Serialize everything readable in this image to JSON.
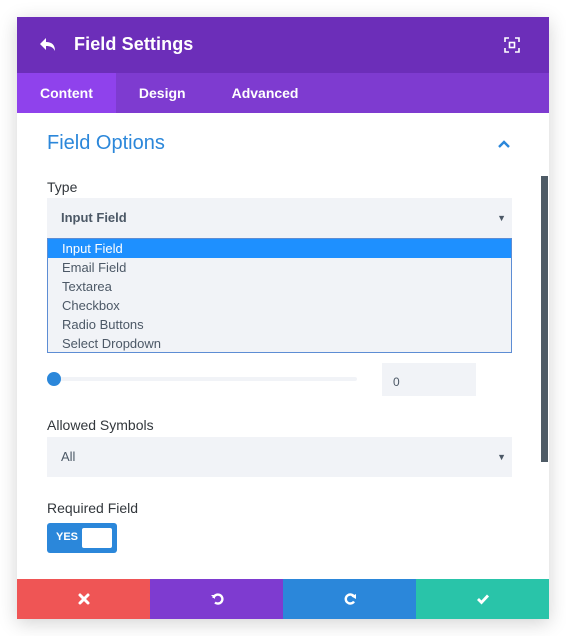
{
  "header": {
    "title": "Field Settings",
    "back_icon": "undo-arrow-icon",
    "expand_icon": "fullscreen-icon"
  },
  "tabs": [
    {
      "label": "Content",
      "active": true
    },
    {
      "label": "Design",
      "active": false
    },
    {
      "label": "Advanced",
      "active": false
    }
  ],
  "section": {
    "title": "Field Options",
    "collapse_icon": "chevron-up-icon"
  },
  "type_field": {
    "label": "Type",
    "value": "Input Field",
    "options": [
      "Input Field",
      "Email Field",
      "Textarea",
      "Checkbox",
      "Radio Buttons",
      "Select Dropdown"
    ],
    "selected_index": 0
  },
  "slider_field": {
    "value": "0",
    "fraction": 0
  },
  "allowed_symbols": {
    "label": "Allowed Symbols",
    "value": "All"
  },
  "required_field": {
    "label": "Required Field",
    "toggle_label": "YES",
    "on": true
  },
  "footer": {
    "buttons": [
      {
        "name": "cancel",
        "icon": "close-icon",
        "color": "#ef5555"
      },
      {
        "name": "undo",
        "icon": "undo-icon",
        "color": "#7e3bd0"
      },
      {
        "name": "redo",
        "icon": "redo-icon",
        "color": "#2b87da"
      },
      {
        "name": "save",
        "icon": "check-icon",
        "color": "#29c4a9"
      }
    ]
  },
  "colors": {
    "header": "#6c2eb9",
    "tabs": "#7e3bd0",
    "active_tab": "#8f42ec",
    "accent": "#2b87da"
  }
}
